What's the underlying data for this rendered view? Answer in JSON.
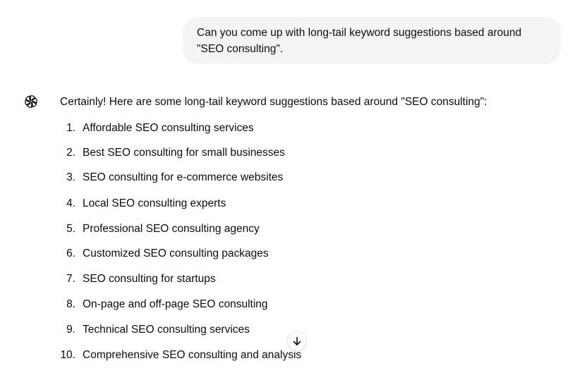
{
  "user_message": {
    "line1": "Can you come up with long-tail keyword suggestions based around",
    "line2": "\"SEO consulting\"."
  },
  "assistant": {
    "avatar_icon": "chatgpt-logo-icon",
    "intro": "Certainly! Here are some long-tail keyword suggestions based around \"SEO consulting\":",
    "items": [
      {
        "num": "1.",
        "text": "Affordable SEO consulting services"
      },
      {
        "num": "2.",
        "text": "Best SEO consulting for small businesses"
      },
      {
        "num": "3.",
        "text": "SEO consulting for e-commerce websites"
      },
      {
        "num": "4.",
        "text": "Local SEO consulting experts"
      },
      {
        "num": "5.",
        "text": "Professional SEO consulting agency"
      },
      {
        "num": "6.",
        "text": "Customized SEO consulting packages"
      },
      {
        "num": "7.",
        "text": "SEO consulting for startups"
      },
      {
        "num": "8.",
        "text": "On-page and off-page SEO consulting"
      },
      {
        "num": "9.",
        "text": "Technical SEO consulting services"
      },
      {
        "num": "10.",
        "text": "Comprehensive SEO consulting and analysis"
      }
    ]
  },
  "scroll_button": {
    "icon": "arrow-down-icon"
  }
}
